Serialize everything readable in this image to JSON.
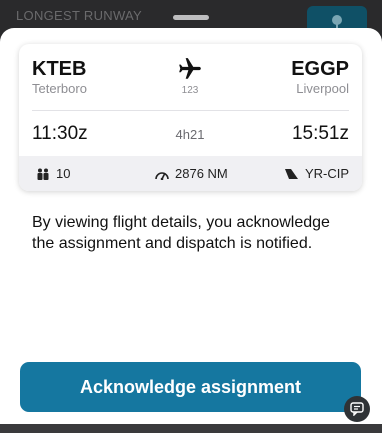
{
  "background": {
    "label": "LONGEST RUNWAY",
    "map_button_icon": "map-pin-icon"
  },
  "flight": {
    "origin": {
      "code": "KTEB",
      "city": "Teterboro"
    },
    "destination": {
      "code": "EGGP",
      "city": "Liverpool"
    },
    "flight_number": "123",
    "departure_time": "11:30z",
    "arrival_time": "15:51z",
    "duration": "4h21",
    "passengers": "10",
    "distance": "2876 NM",
    "registration": "YR-CIP"
  },
  "notice": "By viewing flight details, you acknowledge the assignment and dispatch is notified.",
  "actions": {
    "acknowledge_label": "Acknowledge assignment"
  },
  "colors": {
    "accent": "#1577a0",
    "backdrop": "#2a2a2c",
    "info_bar": "#f0f0f3"
  }
}
